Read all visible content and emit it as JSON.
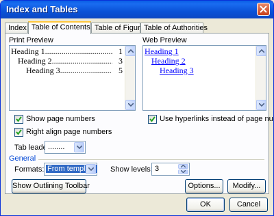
{
  "window": {
    "title": "Index and Tables"
  },
  "tabs": [
    {
      "label": "Index"
    },
    {
      "label": "Table of Contents"
    },
    {
      "label": "Table of Figures"
    },
    {
      "label": "Table of Authorities"
    }
  ],
  "print_preview": {
    "label": "Print Preview",
    "lines": [
      {
        "text": "Heading 1",
        "page": "1"
      },
      {
        "text": "Heading 2",
        "page": "3"
      },
      {
        "text": "Heading 3",
        "page": "5"
      }
    ]
  },
  "web_preview": {
    "label": "Web Preview",
    "lines": [
      {
        "text": "Heading 1"
      },
      {
        "text": "Heading 2"
      },
      {
        "text": "Heading 3"
      }
    ]
  },
  "options": {
    "show_page_numbers": {
      "label": "Show page numbers",
      "checked": true
    },
    "right_align": {
      "label": "Right align page numbers",
      "checked": true
    },
    "use_hyperlinks": {
      "label": "Use hyperlinks instead of page numbers",
      "checked": true
    },
    "tab_leader": {
      "label": "Tab leader:",
      "value": "........"
    }
  },
  "general": {
    "label": "General",
    "formats": {
      "label": "Formats:",
      "value": "From template"
    },
    "show_levels": {
      "label": "Show levels:",
      "value": "3"
    }
  },
  "buttons": {
    "outlining": "Show Outlining Toolbar",
    "options": "Options...",
    "modify": "Modify...",
    "ok": "OK",
    "cancel": "Cancel"
  },
  "colors": {
    "titlebar": "#0a52d8",
    "accent_tab": "#ffc73c",
    "hyperlink": "#0000ff",
    "group_label": "#0046d5"
  }
}
